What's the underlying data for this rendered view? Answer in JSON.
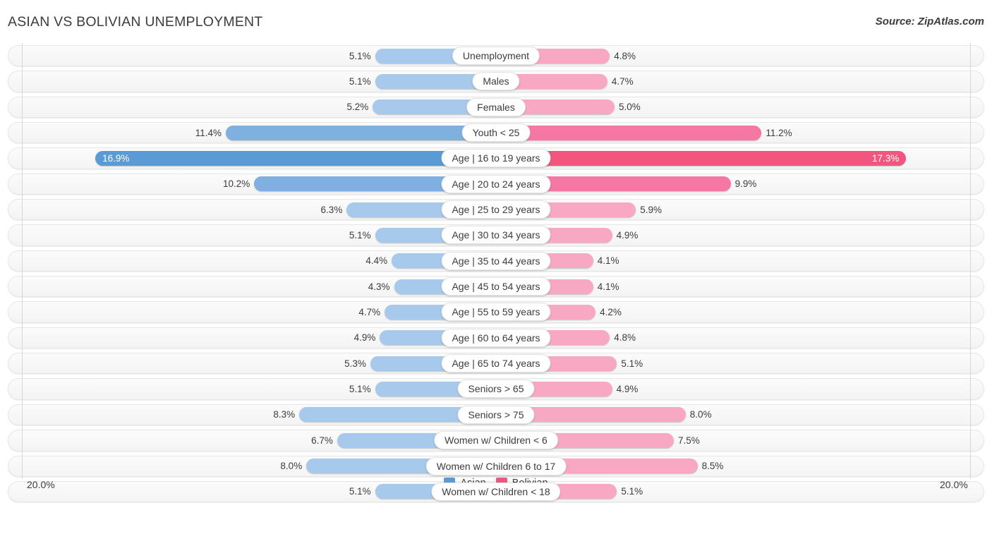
{
  "header": {
    "title": "ASIAN VS BOLIVIAN UNEMPLOYMENT",
    "source": "Source: ZipAtlas.com"
  },
  "axis": {
    "left_label": "20.0%",
    "right_label": "20.0%",
    "max": 20.0
  },
  "legend": {
    "items": [
      {
        "label": "Asian",
        "color": "#5B9BD5"
      },
      {
        "label": "Bolivian",
        "color": "#F2567E"
      }
    ]
  },
  "colors": {
    "asian_light": "#A6C9EC",
    "asian_mid": "#7FB0E0",
    "asian_dark": "#5B9BD5",
    "bolivian_light": "#F9A8C4",
    "bolivian_mid": "#F578A4",
    "bolivian_dark": "#F2567E",
    "track": "#F4F4F4",
    "gridline": "#D6D6D6",
    "text": "#3C3C3C"
  },
  "chart_data": {
    "type": "bar",
    "orientation": "horizontal-diverging",
    "title": "ASIAN VS BOLIVIAN UNEMPLOYMENT",
    "xlabel": "",
    "ylabel": "",
    "xlim": [
      0,
      20
    ],
    "grid": true,
    "legend_position": "bottom-center",
    "categories": [
      "Unemployment",
      "Males",
      "Females",
      "Youth < 25",
      "Age | 16 to 19 years",
      "Age | 20 to 24 years",
      "Age | 25 to 29 years",
      "Age | 30 to 34 years",
      "Age | 35 to 44 years",
      "Age | 45 to 54 years",
      "Age | 55 to 59 years",
      "Age | 60 to 64 years",
      "Age | 65 to 74 years",
      "Seniors > 65",
      "Seniors > 75",
      "Women w/ Children < 6",
      "Women w/ Children 6 to 17",
      "Women w/ Children < 18"
    ],
    "series": [
      {
        "name": "Asian",
        "color": "#5B9BD5",
        "side": "left",
        "values": [
          5.1,
          5.1,
          5.2,
          11.4,
          16.9,
          10.2,
          6.3,
          5.1,
          4.4,
          4.3,
          4.7,
          4.9,
          5.3,
          5.1,
          8.3,
          6.7,
          8.0,
          5.1
        ],
        "labels": [
          "5.1%",
          "5.1%",
          "5.2%",
          "11.4%",
          "16.9%",
          "10.2%",
          "6.3%",
          "5.1%",
          "4.4%",
          "4.3%",
          "4.7%",
          "4.9%",
          "5.3%",
          "5.1%",
          "8.3%",
          "6.7%",
          "8.0%",
          "5.1%"
        ]
      },
      {
        "name": "Bolivian",
        "color": "#F2567E",
        "side": "right",
        "values": [
          4.8,
          4.7,
          5.0,
          11.2,
          17.3,
          9.9,
          5.9,
          4.9,
          4.1,
          4.1,
          4.2,
          4.8,
          5.1,
          4.9,
          8.0,
          7.5,
          8.5,
          5.1
        ],
        "labels": [
          "4.8%",
          "4.7%",
          "5.0%",
          "11.2%",
          "17.3%",
          "9.9%",
          "5.9%",
          "4.9%",
          "4.1%",
          "4.1%",
          "4.2%",
          "4.8%",
          "5.1%",
          "4.9%",
          "8.0%",
          "7.5%",
          "8.5%",
          "5.1%"
        ]
      }
    ]
  }
}
